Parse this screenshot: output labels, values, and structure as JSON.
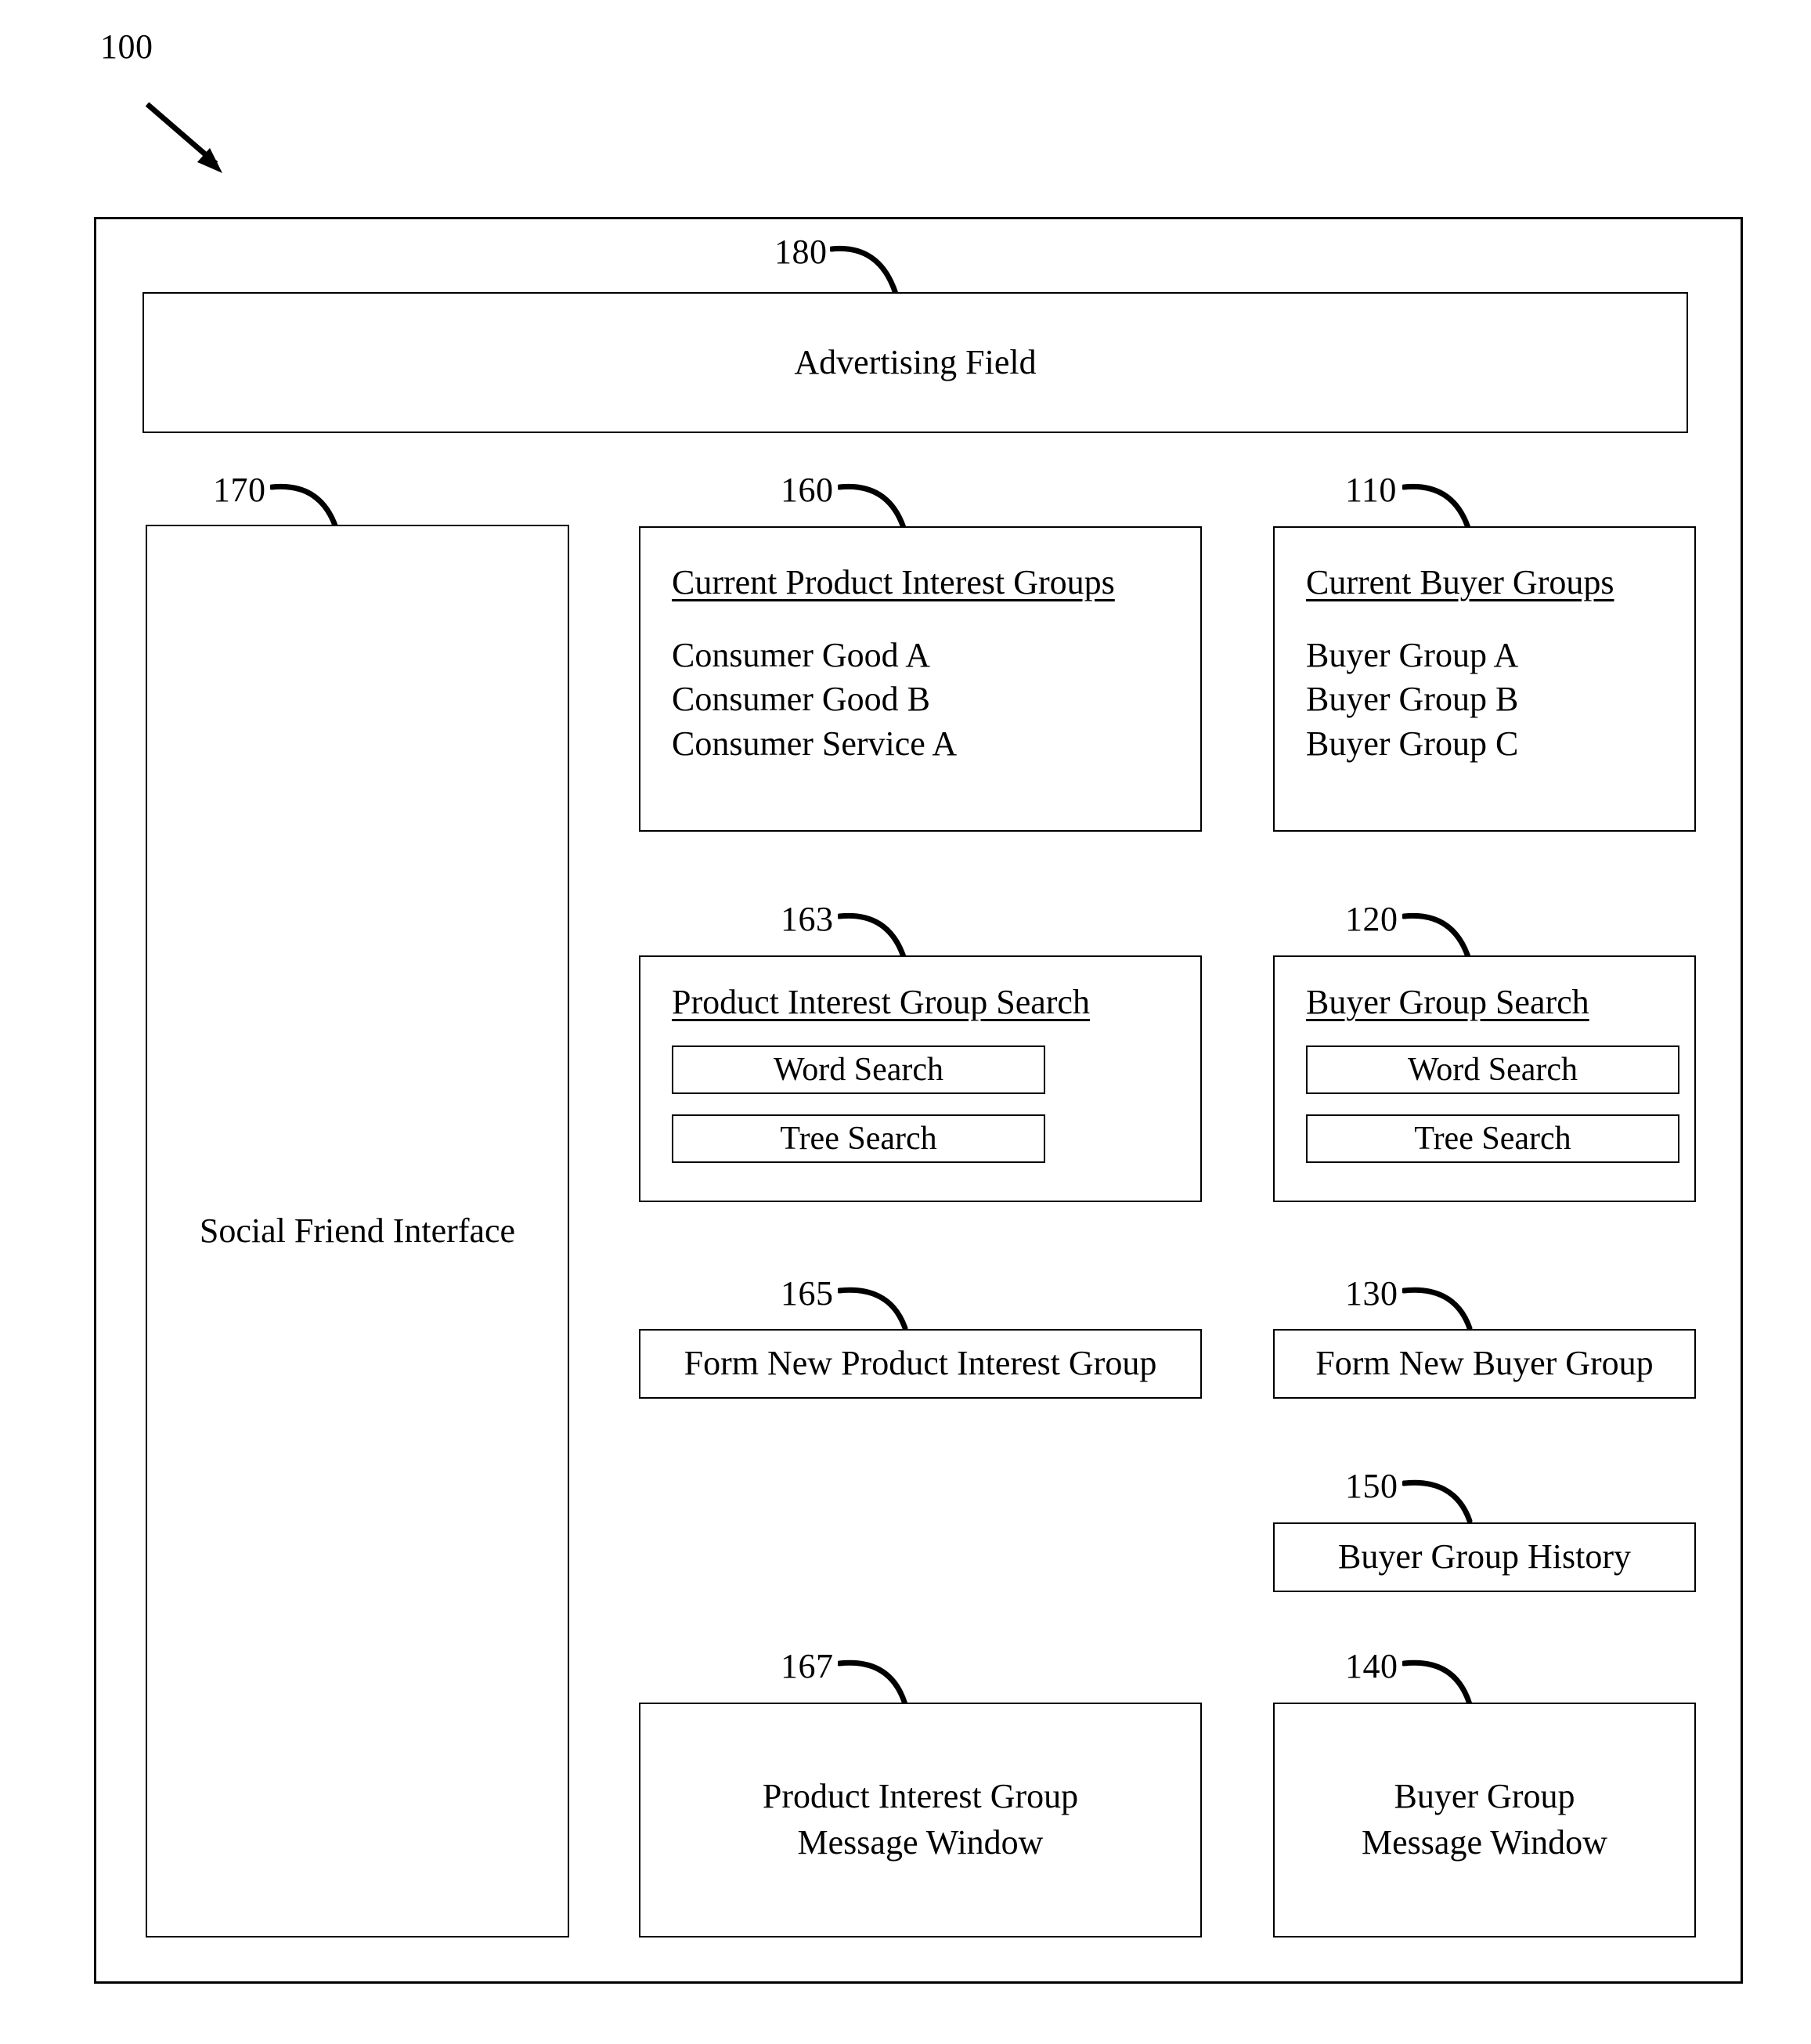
{
  "figure": {
    "number": "100"
  },
  "frame": {
    "ref": "100"
  },
  "advertising_field": {
    "ref": "180",
    "label": "Advertising Field"
  },
  "social_friend_interface": {
    "ref": "170",
    "label": "Social Friend Interface"
  },
  "current_product_interest_groups": {
    "ref": "160",
    "title": "Current Product Interest Groups",
    "items": [
      "Consumer Good A",
      "Consumer Good B",
      "Consumer Service A"
    ]
  },
  "current_buyer_groups": {
    "ref": "110",
    "title": "Current Buyer Groups",
    "items": [
      "Buyer Group A",
      "Buyer Group B",
      "Buyer Group C"
    ]
  },
  "product_interest_group_search": {
    "ref": "163",
    "title": "Product Interest Group Search",
    "word_search": "Word Search",
    "tree_search": "Tree Search"
  },
  "buyer_group_search": {
    "ref": "120",
    "title": "Buyer Group Search",
    "word_search": "Word Search",
    "tree_search": "Tree Search"
  },
  "form_new_product_interest_group": {
    "ref": "165",
    "label": "Form New Product Interest Group"
  },
  "form_new_buyer_group": {
    "ref": "130",
    "label": "Form New Buyer Group"
  },
  "buyer_group_history": {
    "ref": "150",
    "label": "Buyer Group History"
  },
  "product_interest_group_message_window": {
    "ref": "167",
    "label": "Product Interest Group\nMessage Window"
  },
  "buyer_group_message_window": {
    "ref": "140",
    "label": "Buyer Group\nMessage Window"
  },
  "colors": {
    "line": "#000000",
    "background": "#ffffff",
    "text": "#000000"
  }
}
